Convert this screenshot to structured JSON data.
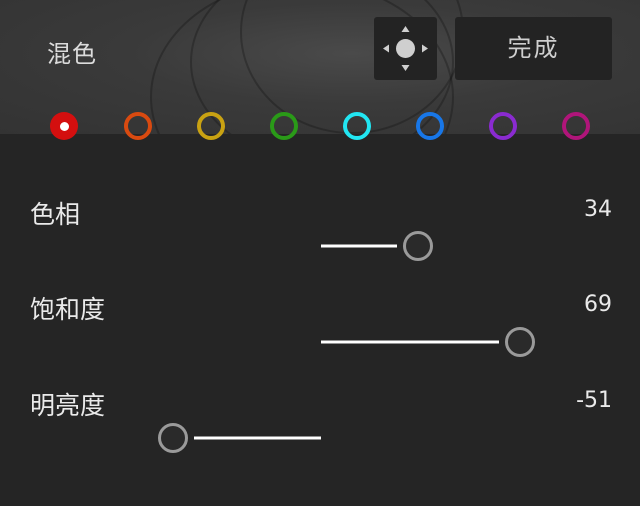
{
  "header": {
    "title": "混色",
    "move_icon": "move-target-icon",
    "done_label": "完成"
  },
  "swatches": [
    {
      "name": "red",
      "color": "#d40f0f",
      "selected": true
    },
    {
      "name": "orange",
      "color": "#d94a10",
      "selected": false
    },
    {
      "name": "yellow",
      "color": "#c9a212",
      "selected": false
    },
    {
      "name": "green",
      "color": "#2a9a18",
      "selected": false
    },
    {
      "name": "aqua",
      "color": "#22e6f2",
      "selected": false
    },
    {
      "name": "blue",
      "color": "#1877e8",
      "selected": false
    },
    {
      "name": "purple",
      "color": "#8a2bd0",
      "selected": false
    },
    {
      "name": "magenta",
      "color": "#b0157a",
      "selected": false
    }
  ],
  "sliders": [
    {
      "id": "hue",
      "label": "色相",
      "value": "34",
      "fraction": 0.667,
      "left_color": "#c03bbd",
      "right_color": "#c87a3a",
      "right_start": "#b8403a"
    },
    {
      "id": "saturation",
      "label": "饱和度",
      "value": "69",
      "fraction": 0.842,
      "left_color": "#4a4a4a",
      "right_color": "#c84040",
      "right_start": "#b85a5a"
    },
    {
      "id": "luminance",
      "label": "明亮度",
      "value": "-51",
      "fraction": 0.245,
      "left_color": "#1e1414",
      "right_color": "#d2aaaa",
      "right_start": "#7a5050"
    }
  ]
}
